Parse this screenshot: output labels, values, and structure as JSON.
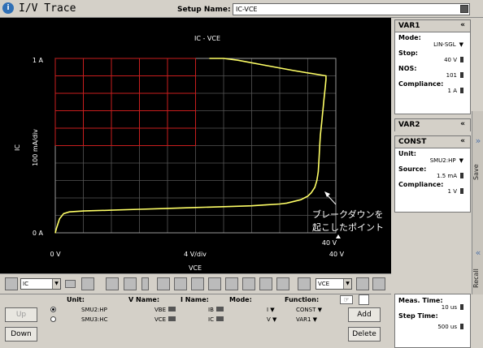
{
  "app": {
    "icon": "i",
    "title": "I/V Trace"
  },
  "setup": {
    "label": "Setup Name:",
    "value": "IC-VCE"
  },
  "chart_data": {
    "type": "line",
    "title": "IC - VCE",
    "xlabel": "VCE",
    "ylabel": "IC",
    "x_scale_label": "4 V/div",
    "y_scale_label": "100 mA/div",
    "x_min_label": "0 V",
    "x_max_label": "40 V",
    "y_min_label": "0 A",
    "y_max_label": "1 A",
    "xlim": [
      0,
      40
    ],
    "ylim": [
      0,
      1
    ],
    "grid": true,
    "series": [
      {
        "color": "#ffff66",
        "x": [
          0,
          0.2,
          0.6,
          1.2,
          2,
          4,
          8,
          12,
          16,
          20,
          24,
          28,
          30,
          32,
          33,
          34,
          35,
          36,
          36.5,
          37,
          37.3,
          37.5,
          37.6,
          37.7,
          37.8,
          37.9,
          38,
          38.1,
          38.2,
          38.3,
          38.4,
          38.5,
          38.6,
          38.6,
          34,
          30,
          26,
          24,
          22
        ],
        "y": [
          0,
          0.03,
          0.08,
          0.11,
          0.12,
          0.125,
          0.13,
          0.135,
          0.14,
          0.145,
          0.15,
          0.155,
          0.16,
          0.165,
          0.17,
          0.18,
          0.19,
          0.21,
          0.23,
          0.26,
          0.3,
          0.35,
          0.42,
          0.5,
          0.56,
          0.6,
          0.64,
          0.68,
          0.72,
          0.76,
          0.8,
          0.84,
          0.88,
          0.9,
          0.93,
          0.96,
          0.99,
          1.0,
          1.0
        ]
      }
    ],
    "annotation_line1": "ブレークダウンを",
    "annotation_line2": "起こしたポイント",
    "annotation_value": "40 V"
  },
  "side": {
    "var1": {
      "title": "VAR1",
      "mode_label": "Mode:",
      "mode": "LIN-SGL",
      "stop_label": "Stop:",
      "stop": "40 V",
      "nos_label": "NOS:",
      "nos": "101",
      "comp_label": "Compliance:",
      "comp": "1 A"
    },
    "var2": {
      "title": "VAR2"
    },
    "const": {
      "title": "CONST",
      "unit_label": "Unit:",
      "unit": "SMU2:HP",
      "source_label": "Source:",
      "source": "1.5 mA",
      "comp_label": "Compliance:",
      "comp": "1 V"
    }
  },
  "tabs": {
    "save": "Save",
    "recall": "Recall"
  },
  "toolbar": {
    "y_select": "IC",
    "x_select": "VCE"
  },
  "bottom": {
    "up": "Up",
    "down": "Down",
    "add": "Add",
    "delete": "Delete",
    "headers": {
      "unit": "Unit:",
      "vname": "V Name:",
      "iname": "I Name:",
      "mode": "Mode:",
      "func": "Function:"
    },
    "rows": [
      {
        "unit": "SMU2:HP",
        "vname": "VBE",
        "iname": "IB",
        "mode": "I",
        "func": "CONST"
      },
      {
        "unit": "SMU3:HC",
        "vname": "VCE",
        "iname": "IC",
        "mode": "V",
        "func": "VAR1"
      }
    ]
  },
  "meas": {
    "meas_label": "Meas. Time:",
    "meas": "10 us",
    "step_label": "Step Time:",
    "step": "500 us"
  }
}
